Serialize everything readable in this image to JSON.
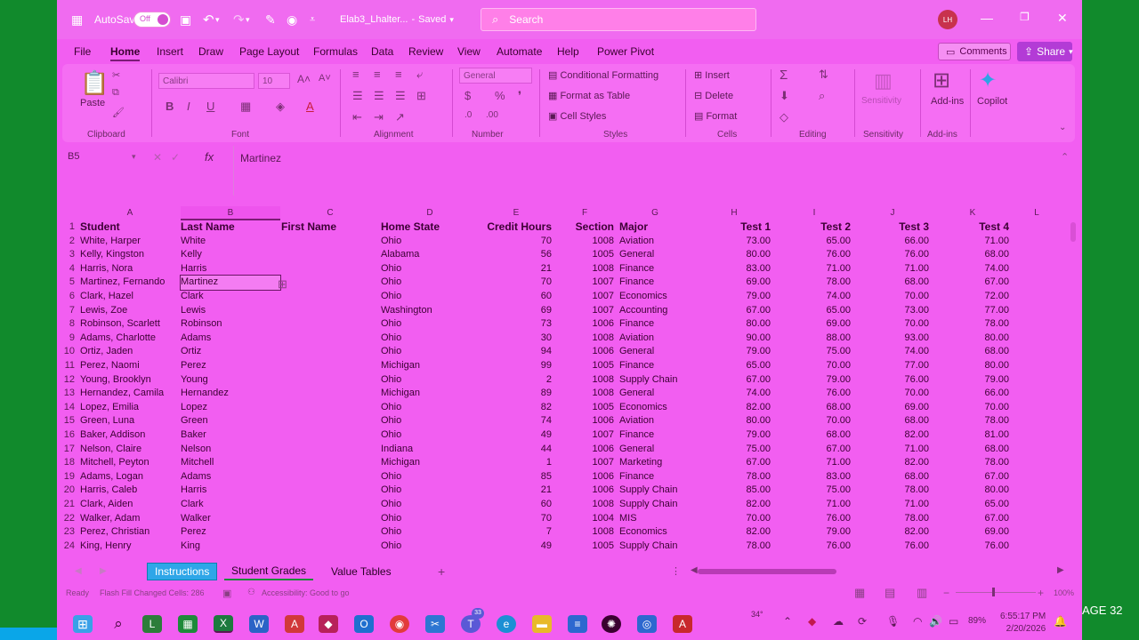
{
  "title_bar": {
    "autosave_label": "AutoSave",
    "autosave_state": "Off",
    "filename": "Elab3_Lhalter...",
    "saved_status": "Saved",
    "search_placeholder": "Search",
    "user_initials": "LH"
  },
  "ribbon_tabs": [
    "File",
    "Home",
    "Insert",
    "Draw",
    "Page Layout",
    "Formulas",
    "Data",
    "Review",
    "View",
    "Automate",
    "Help",
    "Power Pivot"
  ],
  "ribbon_actions": {
    "comments": "Comments",
    "share": "Share"
  },
  "ribbon": {
    "clipboard": {
      "label": "Clipboard",
      "paste": "Paste"
    },
    "font": {
      "label": "Font",
      "name": "Calibri",
      "size": "10"
    },
    "alignment": {
      "label": "Alignment"
    },
    "number": {
      "label": "Number",
      "format": "General"
    },
    "styles": {
      "label": "Styles",
      "conditional_formatting": "Conditional Formatting",
      "format_as_table": "Format as Table",
      "cell_styles": "Cell Styles"
    },
    "cells": {
      "label": "Cells",
      "insert": "Insert",
      "delete": "Delete",
      "format": "Format"
    },
    "editing": {
      "label": "Editing"
    },
    "sensitivity": {
      "label": "Sensitivity",
      "button": "Sensitivity"
    },
    "addins": {
      "label": "Add-ins",
      "button": "Add-ins"
    },
    "copilot": {
      "button": "Copilot"
    }
  },
  "formula_bar": {
    "name_box": "B5",
    "fx": "fx",
    "value": "Martinez"
  },
  "columns": [
    "A",
    "B",
    "C",
    "D",
    "E",
    "F",
    "G",
    "H",
    "I",
    "J",
    "K",
    "L"
  ],
  "header": {
    "row": "1",
    "student": "Student",
    "last": "Last Name",
    "first": "First Name",
    "state": "Home State",
    "hours": "Credit Hours",
    "section": "Section",
    "major": "Major",
    "t1": "Test 1",
    "t2": "Test 2",
    "t3": "Test 3",
    "t4": "Test 4"
  },
  "rows": [
    [
      "2",
      "White, Harper",
      "White",
      "Ohio",
      "70",
      "1008",
      "Aviation",
      "73.00",
      "65.00",
      "66.00",
      "71.00"
    ],
    [
      "3",
      "Kelly, Kingston",
      "Kelly",
      "Alabama",
      "56",
      "1005",
      "General",
      "80.00",
      "76.00",
      "76.00",
      "68.00"
    ],
    [
      "4",
      "Harris, Nora",
      "Harris",
      "Ohio",
      "21",
      "1008",
      "Finance",
      "83.00",
      "71.00",
      "71.00",
      "74.00"
    ],
    [
      "5",
      "Martinez, Fernando",
      "Martinez",
      "Ohio",
      "70",
      "1007",
      "Finance",
      "69.00",
      "78.00",
      "68.00",
      "67.00"
    ],
    [
      "6",
      "Clark, Hazel",
      "Clark",
      "Ohio",
      "60",
      "1007",
      "Economics",
      "79.00",
      "74.00",
      "70.00",
      "72.00"
    ],
    [
      "7",
      "Lewis, Zoe",
      "Lewis",
      "Washington",
      "69",
      "1007",
      "Accounting",
      "67.00",
      "65.00",
      "73.00",
      "77.00"
    ],
    [
      "8",
      "Robinson, Scarlett",
      "Robinson",
      "Ohio",
      "73",
      "1006",
      "Finance",
      "80.00",
      "69.00",
      "70.00",
      "78.00"
    ],
    [
      "9",
      "Adams, Charlotte",
      "Adams",
      "Ohio",
      "30",
      "1008",
      "Aviation",
      "90.00",
      "88.00",
      "93.00",
      "80.00"
    ],
    [
      "10",
      "Ortiz, Jaden",
      "Ortiz",
      "Ohio",
      "94",
      "1006",
      "General",
      "79.00",
      "75.00",
      "74.00",
      "68.00"
    ],
    [
      "11",
      "Perez, Naomi",
      "Perez",
      "Michigan",
      "99",
      "1005",
      "Finance",
      "65.00",
      "70.00",
      "77.00",
      "80.00"
    ],
    [
      "12",
      "Young, Brooklyn",
      "Young",
      "Ohio",
      "2",
      "1008",
      "Supply Chain",
      "67.00",
      "79.00",
      "76.00",
      "79.00"
    ],
    [
      "13",
      "Hernandez, Camila",
      "Hernandez",
      "Michigan",
      "89",
      "1008",
      "General",
      "74.00",
      "76.00",
      "70.00",
      "66.00"
    ],
    [
      "14",
      "Lopez, Emilia",
      "Lopez",
      "Ohio",
      "82",
      "1005",
      "Economics",
      "82.00",
      "68.00",
      "69.00",
      "70.00"
    ],
    [
      "15",
      "Green, Luna",
      "Green",
      "Ohio",
      "74",
      "1006",
      "Aviation",
      "80.00",
      "70.00",
      "68.00",
      "78.00"
    ],
    [
      "16",
      "Baker, Addison",
      "Baker",
      "Ohio",
      "49",
      "1007",
      "Finance",
      "79.00",
      "68.00",
      "82.00",
      "81.00"
    ],
    [
      "17",
      "Nelson, Claire",
      "Nelson",
      "Indiana",
      "44",
      "1006",
      "General",
      "75.00",
      "67.00",
      "71.00",
      "68.00"
    ],
    [
      "18",
      "Mitchell, Peyton",
      "Mitchell",
      "Michigan",
      "1",
      "1007",
      "Marketing",
      "67.00",
      "71.00",
      "82.00",
      "78.00"
    ],
    [
      "19",
      "Adams, Logan",
      "Adams",
      "Ohio",
      "85",
      "1006",
      "Finance",
      "78.00",
      "83.00",
      "68.00",
      "67.00"
    ],
    [
      "20",
      "Harris, Caleb",
      "Harris",
      "Ohio",
      "21",
      "1006",
      "Supply Chain",
      "85.00",
      "75.00",
      "78.00",
      "80.00"
    ],
    [
      "21",
      "Clark, Aiden",
      "Clark",
      "Ohio",
      "60",
      "1008",
      "Supply Chain",
      "82.00",
      "71.00",
      "71.00",
      "65.00"
    ],
    [
      "22",
      "Walker, Adam",
      "Walker",
      "Ohio",
      "70",
      "1004",
      "MIS",
      "70.00",
      "76.00",
      "78.00",
      "67.00"
    ],
    [
      "23",
      "Perez, Christian",
      "Perez",
      "Ohio",
      "7",
      "1008",
      "Economics",
      "82.00",
      "79.00",
      "82.00",
      "69.00"
    ],
    [
      "24",
      "King, Henry",
      "King",
      "Ohio",
      "49",
      "1005",
      "Supply Chain",
      "78.00",
      "76.00",
      "76.00",
      "76.00"
    ]
  ],
  "sheet_tabs": {
    "instructions": "Instructions",
    "student_grades": "Student Grades",
    "value_tables": "Value Tables",
    "add": "+"
  },
  "status_bar": {
    "ready": "Ready",
    "flash_fill": "Flash Fill Changed Cells: 286",
    "accessibility": "Accessibility: Good to go",
    "zoom": "100%"
  },
  "taskbar": {
    "temp": "34°",
    "battery": "89%",
    "time": "6:55:17 PM",
    "date": "2/20/2026",
    "notification_count": "33"
  },
  "page_label": "AGE 32",
  "colors": {
    "accent": "#f25ef1",
    "background": "#118a2c",
    "share": "#b33bd6"
  }
}
